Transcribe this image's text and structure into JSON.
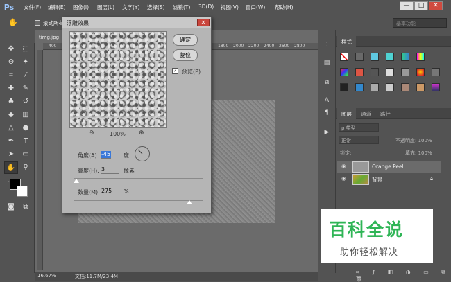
{
  "app": {
    "logo": "Ps"
  },
  "menu": [
    "文件(F)",
    "编辑(E)",
    "图像(I)",
    "图层(L)",
    "文字(Y)",
    "选择(S)",
    "滤镜(T)",
    "3D(D)",
    "视图(V)",
    "窗口(W)",
    "帮助(H)"
  ],
  "window_controls": {
    "min": "—",
    "max": "□",
    "close": "✕"
  },
  "options_bar": {
    "scroll_all": "滚动所有",
    "workspace": "基本功能"
  },
  "document": {
    "tab": "timg.jpg",
    "ruler_marks": [
      "400",
      "1800",
      "2000",
      "2200",
      "2400",
      "2600",
      "2800"
    ],
    "zoom": "16.67%",
    "doc_info": "文档:11.7M/23.4M"
  },
  "dialog": {
    "title": "浮雕效果",
    "ok": "确定",
    "reset": "复位",
    "preview_label": "预览(P)",
    "preview_checked": true,
    "zoom_out": "⊖",
    "zoom_pct": "100%",
    "zoom_in": "⊕",
    "angle_label": "角度(A):",
    "angle_value": "-45",
    "angle_unit": "度",
    "height_label": "高度(H):",
    "height_value": "3",
    "height_unit": "像素",
    "amount_label": "数量(M):",
    "amount_value": "275",
    "amount_unit": "%"
  },
  "panels": {
    "styles_tab": "样式",
    "layers_tabs": [
      "图层",
      "通道",
      "路径"
    ],
    "kind_label": "ρ 类型",
    "blend_mode": "正常",
    "opacity_label": "不透明度: 100%",
    "lock_label": "锁定:",
    "fill_label": "填充: 100%",
    "layers": [
      {
        "name": "Orange Peel"
      },
      {
        "name": "背景"
      }
    ]
  },
  "watermark": {
    "big": "百科全说",
    "small": "助你轻松解决"
  },
  "colors": {
    "accent_green": "#2fb556",
    "dialog_bg": "#b5b5b5"
  }
}
